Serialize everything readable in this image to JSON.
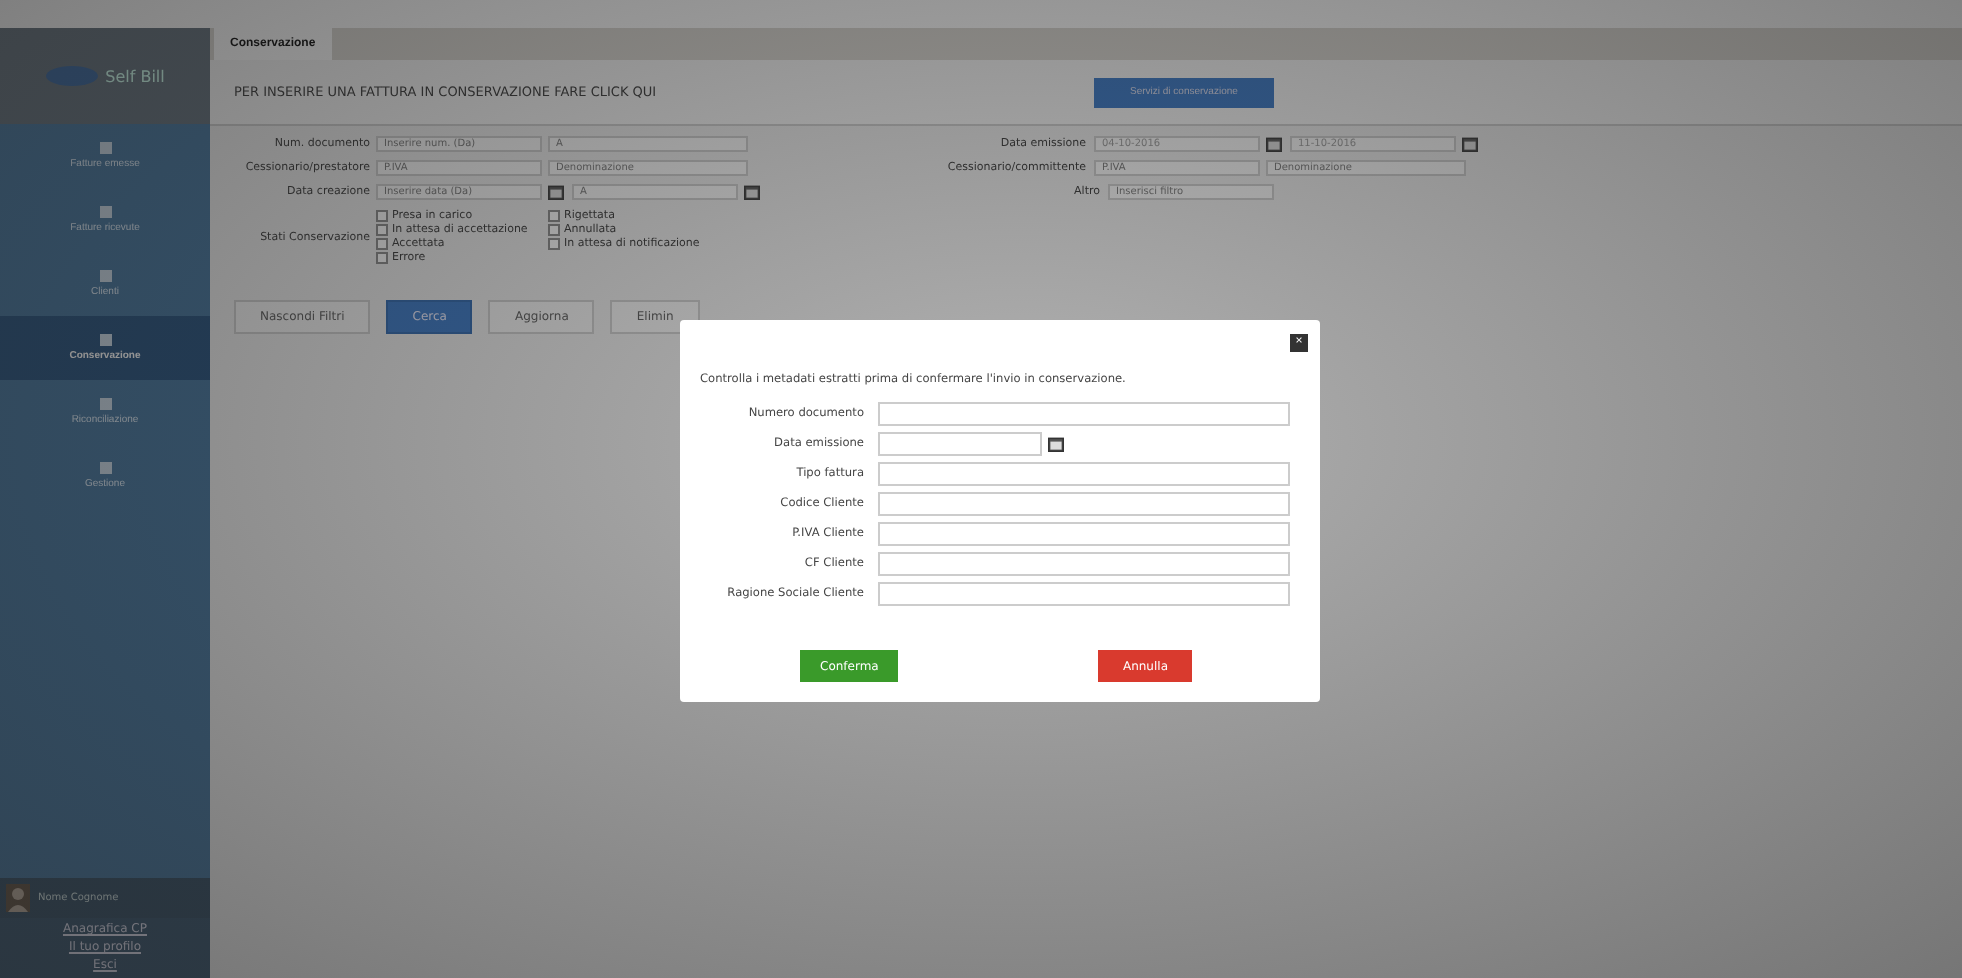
{
  "logo": {
    "text": "Self Bill"
  },
  "sidebar": {
    "items": [
      {
        "label": "Fatture emesse",
        "selected": false
      },
      {
        "label": "Fatture ricevute",
        "selected": false
      },
      {
        "label": "Clienti",
        "selected": false
      },
      {
        "label": "Conservazione",
        "selected": true
      },
      {
        "label": "Riconciliazione",
        "selected": false
      },
      {
        "label": "Gestione",
        "selected": false
      }
    ],
    "user": {
      "name": "Nome Cognome",
      "links": [
        "Anagrafica CP",
        "Il tuo profilo",
        "Esci"
      ]
    }
  },
  "tabs": [
    {
      "label": "Conservazione",
      "selected": true
    }
  ],
  "banner": {
    "text": "PER INSERIRE UNA FATTURA IN CONSERVAZIONE FARE CLICK QUI",
    "button": "Servizi di conservazione"
  },
  "filters": {
    "rows": [
      {
        "label": "Num. documento",
        "fields": [
          {
            "kind": "text",
            "placeholder": "Inserire num. (Da)"
          },
          {
            "kind": "text",
            "placeholder": "A"
          }
        ],
        "right_label": "Data emissione",
        "right_fields": [
          {
            "kind": "date",
            "value": "04-10-2016"
          },
          {
            "kind": "date",
            "value": "11-10-2016"
          }
        ]
      },
      {
        "label": "Cessionario/prestatore",
        "fields": [
          {
            "kind": "text",
            "placeholder": "P.IVA"
          },
          {
            "kind": "text",
            "placeholder": "Denominazione"
          }
        ],
        "right_label": "Cessionario/committente",
        "right_fields": [
          {
            "kind": "text",
            "placeholder": "P.IVA"
          },
          {
            "kind": "text",
            "placeholder": "Denominazione"
          }
        ]
      },
      {
        "label": "Data creazione",
        "fields": [
          {
            "kind": "date",
            "placeholder": "Inserire data (Da)"
          },
          {
            "kind": "date",
            "placeholder": "A"
          }
        ],
        "right_label": "Altro",
        "right_fields": [
          {
            "kind": "text",
            "placeholder": "Inserisci filtro"
          }
        ]
      }
    ],
    "states_label": "Stati Conservazione",
    "states": [
      {
        "label": "Presa in carico",
        "checked": false
      },
      {
        "label": "Rigettata",
        "checked": false
      },
      {
        "label": "In attesa di accettazione",
        "checked": false
      },
      {
        "label": "Annullata",
        "checked": false
      },
      {
        "label": "Accettata",
        "checked": false
      },
      {
        "label": "In attesa di notificazione",
        "checked": false
      },
      {
        "label": "Errore",
        "checked": false
      }
    ],
    "buttons": [
      {
        "label": "Nascondi Filtri",
        "kind": "default"
      },
      {
        "label": "Cerca",
        "kind": "primary"
      },
      {
        "label": "Aggiorna",
        "kind": "default"
      },
      {
        "label": "Elimin",
        "kind": "default"
      }
    ]
  },
  "modal": {
    "close": "×",
    "message": "Controlla i metadati estratti prima di confermare l'invio in conservazione.",
    "fields": [
      {
        "label": "Numero documento",
        "kind": "text"
      },
      {
        "label": "Data emissione",
        "kind": "date"
      },
      {
        "label": "Tipo fattura",
        "kind": "text"
      },
      {
        "label": "Codice Cliente",
        "kind": "text"
      },
      {
        "label": "P.IVA Cliente",
        "kind": "text"
      },
      {
        "label": "CF Cliente",
        "kind": "text"
      },
      {
        "label": "Ragione Sociale Cliente",
        "kind": "text"
      }
    ],
    "buttons": [
      {
        "label": "Conferma",
        "kind": "confirm"
      },
      {
        "label": "Annulla",
        "kind": "cancel"
      }
    ]
  }
}
